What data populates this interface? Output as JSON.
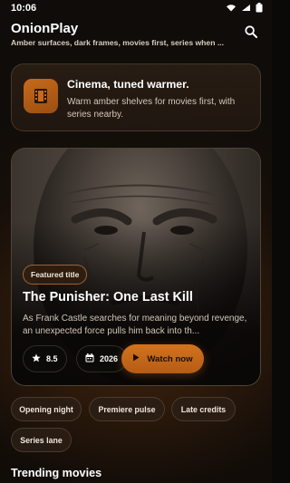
{
  "status": {
    "time": "10:06"
  },
  "header": {
    "title": "OnionPlay",
    "subtitle": "Amber surfaces, dark frames, movies first, series when ..."
  },
  "intro": {
    "title": "Cinema, tuned warmer.",
    "text": "Warm amber shelves for movies first, with series nearby."
  },
  "featured": {
    "badge": "Featured title",
    "title": "The Punisher: One Last Kill",
    "description": "As Frank Castle searches for meaning beyond revenge, an unexpected force pulls him back into th...",
    "rating": "8.5",
    "year": "2026",
    "watch_label": "Watch now"
  },
  "filters": [
    "Opening night",
    "Premiere pulse",
    "Late credits",
    "Series lane"
  ],
  "sections": {
    "trending": "Trending movies"
  },
  "colors": {
    "accent": "#c96a1a",
    "background": "#0f0c09",
    "card": "#2c2017"
  },
  "icons": [
    "wifi-icon",
    "signal-icon",
    "battery-icon",
    "search-icon",
    "film-icon",
    "star-icon",
    "calendar-icon",
    "play-icon"
  ]
}
